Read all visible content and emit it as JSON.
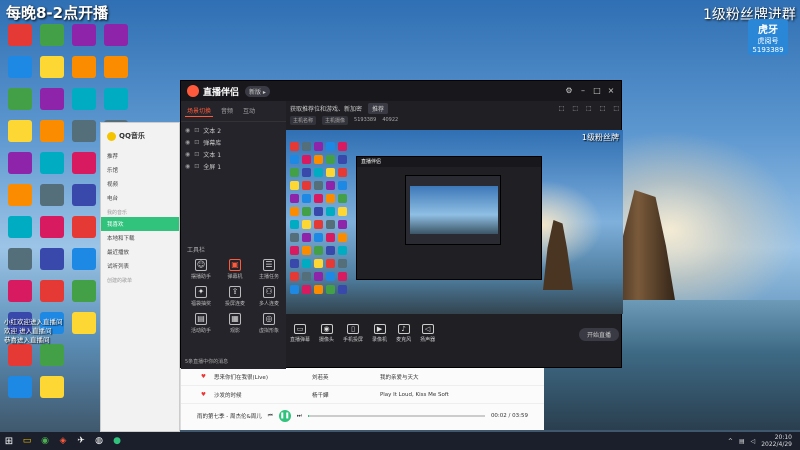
{
  "overlay": {
    "title": "每晚8-2点开播",
    "right_text": "1级粉丝牌进群",
    "brand": "虎牙",
    "brand_sub": "虎阅号",
    "room_number": "5193389"
  },
  "app": {
    "title": "直播伴侣",
    "version": "新版 ▸",
    "tabs": [
      "场景切换",
      "音频",
      "互动"
    ],
    "scenes": [
      "文本 2",
      "弹幕库",
      "文本 1",
      "全屏 1"
    ],
    "tool_heading": "工具栏",
    "tools": [
      {
        "label": "摆播助手",
        "icon": "person-icon"
      },
      {
        "label": "弹幕机",
        "icon": "screen-icon"
      },
      {
        "label": "主播任务",
        "icon": "task-icon"
      },
      {
        "label": "福袋抽奖",
        "icon": "gift-icon"
      },
      {
        "label": "投屏连麦",
        "icon": "cast-icon"
      },
      {
        "label": "多人连麦",
        "icon": "group-icon"
      },
      {
        "label": "活动助手",
        "icon": "calendar-icon"
      },
      {
        "label": "观影",
        "icon": "film-icon"
      },
      {
        "label": "虚拟形象",
        "icon": "avatar-icon"
      }
    ],
    "bottom_tip": "5条直播中你的消息",
    "topbar": {
      "hint": "获取推荐位和游戏、新加密",
      "btn": "推荐",
      "right": [
        "⬚",
        "⬚",
        "⬚",
        "⬚",
        "⬚"
      ]
    },
    "subbar": {
      "pill1": "主机名称",
      "pill2": "主机摄像",
      "stat1": "5193389",
      "stat2": "40922"
    },
    "preview_title": "1级粉丝牌",
    "controls": [
      {
        "label": "直播弹幕",
        "icon": "chat-icon"
      },
      {
        "label": "摄像头",
        "icon": "camera-icon"
      },
      {
        "label": "手机投屏",
        "icon": "phone-icon"
      },
      {
        "label": "录像机",
        "icon": "video-icon"
      },
      {
        "label": "麦克风",
        "icon": "mic-icon"
      },
      {
        "label": "扬声器",
        "icon": "speaker-icon"
      }
    ],
    "start_label": "开始直播"
  },
  "qq": {
    "title": "QQ音乐",
    "items": [
      {
        "label": "推荐",
        "selected": false
      },
      {
        "label": "乐馆",
        "selected": false
      },
      {
        "label": "视频",
        "selected": false
      },
      {
        "label": "电台",
        "selected": false
      }
    ],
    "section": "我的音乐",
    "my_items": [
      {
        "label": "我喜欢",
        "selected": true
      },
      {
        "label": "本地和下载",
        "selected": false
      },
      {
        "label": "最近播放",
        "selected": false
      },
      {
        "label": "试听列表",
        "selected": false
      }
    ],
    "section2": "创建的歌单"
  },
  "songs": [
    {
      "title": "思来你们在我很(Live)",
      "artist": "刘若英",
      "album": "我的亲爱与天大"
    },
    {
      "title": "沙发的时候",
      "artist": "杨千嬅",
      "album": "Play It Loud, Kiss Me Soft"
    }
  ],
  "player": {
    "title": "雨的第七季 - 周杰伦&周儿",
    "time": "00:02 / 03:59",
    "progress": 0.01
  },
  "chat": [
    "小红欢迎进入直播间",
    "欢迎 进入直播间",
    "恭喜进入直播间"
  ],
  "clock": {
    "time": "20:10",
    "date": "2022/4/29"
  }
}
